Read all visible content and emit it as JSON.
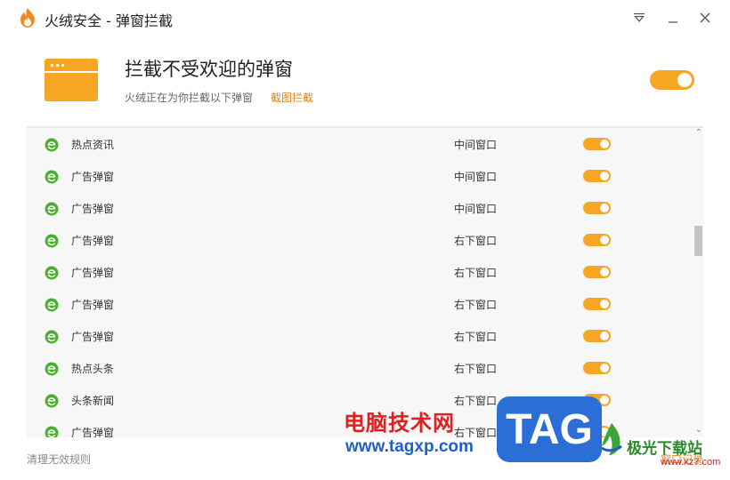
{
  "window": {
    "title": "火绒安全 - 弹窗拦截",
    "controls": {
      "menu_icon": "dropdown-menu-icon",
      "minimize_icon": "minimize-icon",
      "close_icon": "close-icon"
    }
  },
  "header": {
    "title": "拦截不受欢迎的弹窗",
    "description": "火绒正在为你拦截以下弹窗",
    "screenshot_link": "截图拦截",
    "toggle_on": true
  },
  "list": {
    "rows": [
      {
        "name": "热点资讯",
        "position": "中间窗口",
        "enabled": true
      },
      {
        "name": "广告弹窗",
        "position": "中间窗口",
        "enabled": true
      },
      {
        "name": "广告弹窗",
        "position": "中间窗口",
        "enabled": true
      },
      {
        "name": "广告弹窗",
        "position": "右下窗口",
        "enabled": true
      },
      {
        "name": "广告弹窗",
        "position": "右下窗口",
        "enabled": true
      },
      {
        "name": "广告弹窗",
        "position": "右下窗口",
        "enabled": true
      },
      {
        "name": "广告弹窗",
        "position": "右下窗口",
        "enabled": true
      },
      {
        "name": "热点头条",
        "position": "右下窗口",
        "enabled": true
      },
      {
        "name": "头条新闻",
        "position": "右下窗口",
        "enabled": true
      },
      {
        "name": "广告弹窗",
        "position": "右下窗口",
        "enabled": true
      }
    ]
  },
  "footer": {
    "clear_link": "清理无效规则",
    "records_link": "窗口记录"
  },
  "watermark": {
    "site_cn": "电脑技术网",
    "site_url": "www.tagxp.com",
    "tag": "TAG",
    "site2_cn": "极光下载站",
    "site2_url": "www.xz7.com"
  },
  "colors": {
    "accent": "#f6a623",
    "link": "#e8821c",
    "ie_green": "#4caf32"
  }
}
